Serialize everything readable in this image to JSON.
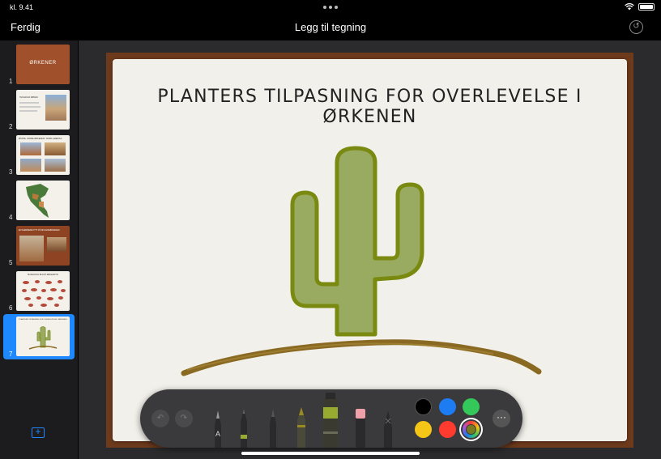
{
  "status": {
    "time": "kl. 9.41"
  },
  "nav": {
    "done_label": "Ferdig",
    "title": "Legg til tegning"
  },
  "slides": [
    {
      "number": "1",
      "title": "ØRKENER"
    },
    {
      "number": "2",
      "title": "HVA ER EN ØRKEN"
    },
    {
      "number": "3",
      "title": "ØSTRE, VARME ØRKENER I NORD-AMERIKA"
    },
    {
      "number": "4",
      "title": ""
    },
    {
      "number": "5",
      "title": "EN NÆRMERE TITT PÅ MOJAVEØRKENEN"
    },
    {
      "number": "6",
      "title": "MANGFOLD BLANT ØRKENDYR"
    },
    {
      "number": "7",
      "title": "PLANTERS TILPASNING FOR OVERLEVELSE I ØRKENEN"
    }
  ],
  "current_slide": {
    "title": "PLANTERS TILPASNING FOR OVERLEVELSE I ØRKENEN"
  },
  "toolbar": {
    "tools": [
      "pen-icon",
      "fineliner-icon",
      "fountain-pen-icon",
      "crayon-icon",
      "marker-icon",
      "eraser-icon",
      "lasso-icon"
    ],
    "colors": [
      "#000000",
      "#1e7cf2",
      "#34c759",
      "#f5c518",
      "#ff3b30",
      "#7a7a22"
    ],
    "selected_color": "#7a7a22"
  }
}
